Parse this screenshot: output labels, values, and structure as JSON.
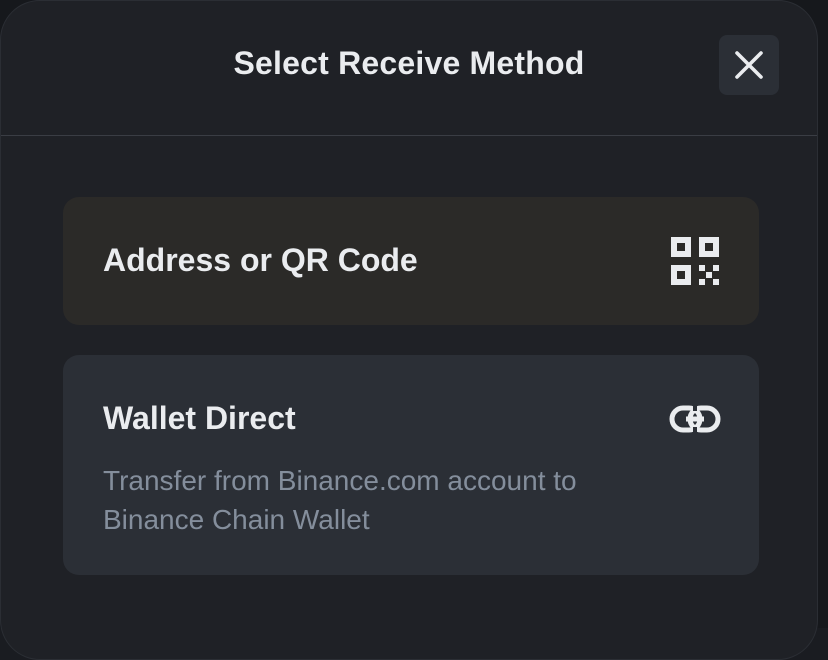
{
  "modal": {
    "title": "Select Receive Method",
    "close_icon": "close-icon"
  },
  "options": [
    {
      "title": "Address or QR Code",
      "icon": "qr-code-icon"
    },
    {
      "title": "Wallet Direct",
      "description": "Transfer from Binance.com account to Binance Chain Wallet",
      "icon": "link-icon"
    }
  ],
  "colors": {
    "background": "#1f2126",
    "text_primary": "#eaecef",
    "text_secondary": "#848e9c",
    "option_highlight": "#2b2a28",
    "option_default": "#2b2f36"
  }
}
